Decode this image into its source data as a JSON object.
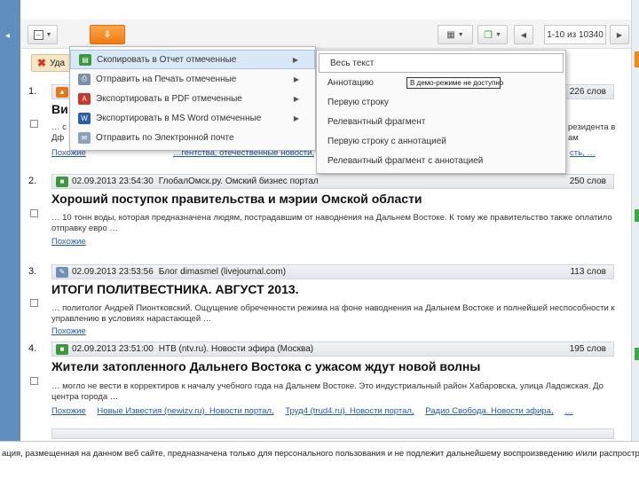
{
  "toolbar": {
    "pager": "1-10 из 10340"
  },
  "action_bar": {
    "delete_label": "Уда"
  },
  "menu_copy": {
    "items": [
      {
        "label": "Скопировать в Отчет отмеченные"
      },
      {
        "label": "Отправить на Печать отмеченные"
      },
      {
        "label": "Экспортировать в PDF отмеченные"
      },
      {
        "label": "Экспортировать в MS Word отмеченные"
      },
      {
        "label": "Отправить по Электронной почте"
      }
    ]
  },
  "submenu": {
    "items": [
      {
        "label": "Весь текст"
      },
      {
        "label": "Аннотацию"
      },
      {
        "label": "Первую строку"
      },
      {
        "label": "Релевантный фрагмент"
      },
      {
        "label": "Первую строку с аннотацией"
      },
      {
        "label": "Релевантный фрагмент с аннотацией"
      }
    ],
    "tooltip": "В демо-режиме не доступно"
  },
  "results": [
    {
      "num": "1.",
      "words": "226 слов",
      "title": "Ви",
      "snippet_a": "… с",
      "snippet_b": "Дф",
      "snippet_right_1": "резидента в",
      "snippet_right_2": "ам",
      "links_left": "Похожие",
      "links_mid": "…гентства, отечественные новости,",
      "links_right": "сть, …"
    },
    {
      "num": "2.",
      "date": "02.09.2013 23:54:30",
      "source": "ГлобалОмск.ру. Омский бизнес портал",
      "words": "250 слов",
      "title": "Хороший поступок правительства и мэрии Омской области",
      "snippet": "… 10 тонн воды, которая предназначена людям, пострадавшим от наводнения на Дальнем Востоке. К тому же правительство также оплатило отправку евро …",
      "links": [
        "Похожие"
      ]
    },
    {
      "num": "3.",
      "date": "02.09.2013 23:53:56",
      "source": "Блог dimasmel (livejournal.com)",
      "words": "113 слов",
      "title": "ИТОГИ ПОЛИТВЕСТНИКА. АВГУСТ 2013.",
      "snippet": "… политолог Андрей Пионтковский. Ощущение обреченности режима на фоне наводнения на Дальнем Востоке и полнейшей неспособности к управлению в условиях нарастающей …",
      "links": [
        "Похожие"
      ]
    },
    {
      "num": "4.",
      "date": "02.09.2013 23:51:00",
      "source": "НТВ (ntv.ru). Новости эфира (Москва)",
      "words": "195 слов",
      "title": "Жители затопленного Дальнего Востока с ужасом ждут новой волны",
      "snippet": "… могло не вести в корректиров к началу учебного года на Дальнем Востоке. Это индустриальный район Хабаровска, улица Ладожская. До центра города …",
      "links": [
        "Похожие",
        "Новые Известия (newizv.ru). Новости портал,",
        "Труд4 (trud4.ru). Новости портал,",
        "Радио Свобода. Новости эфира,",
        "…"
      ]
    }
  ],
  "footer": {
    "text": "ация, размещенная на данном веб сайте, предназначена только для персонального пользования и не подлежит дальнейшему воспроизведению и/или распространению"
  }
}
